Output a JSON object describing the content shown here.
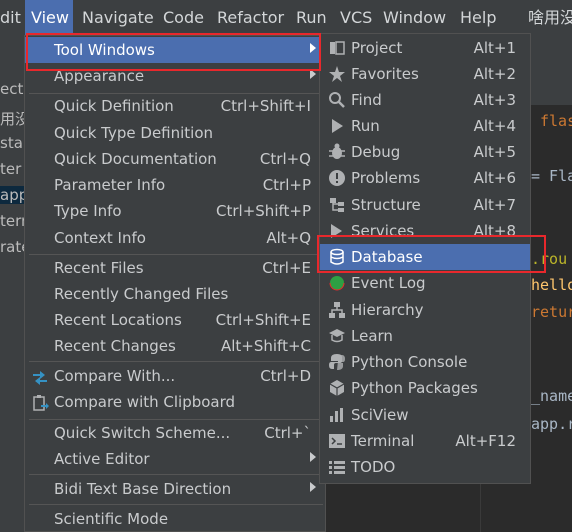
{
  "menubar": {
    "items": [
      {
        "label": "dit"
      },
      {
        "label": "View"
      },
      {
        "label": "Navigate"
      },
      {
        "label": "Code"
      },
      {
        "label": "Refactor"
      },
      {
        "label": "Run"
      },
      {
        "label": "VCS"
      },
      {
        "label": "Window"
      },
      {
        "label": "Help"
      },
      {
        "label": "啥用没"
      }
    ]
  },
  "left_panel": {
    "lines": [
      "ect",
      "用没",
      "sta",
      "ter",
      "app",
      "tern",
      "rate"
    ]
  },
  "editor": {
    "lines": [
      "flas",
      "= Fla",
      ".rou",
      "hello",
      "retur",
      "_name",
      "app.r"
    ]
  },
  "view_menu": {
    "items": [
      {
        "label": "Tool Windows",
        "shortcut": "",
        "submenu": true
      },
      {
        "label": "Appearance",
        "shortcut": "",
        "submenu": true
      },
      {
        "label": "Quick Definition",
        "shortcut": "Ctrl+Shift+I"
      },
      {
        "label": "Quick Type Definition",
        "shortcut": ""
      },
      {
        "label": "Quick Documentation",
        "shortcut": "Ctrl+Q"
      },
      {
        "label": "Parameter Info",
        "shortcut": "Ctrl+P"
      },
      {
        "label": "Type Info",
        "shortcut": "Ctrl+Shift+P"
      },
      {
        "label": "Context Info",
        "shortcut": "Alt+Q"
      },
      {
        "label": "Recent Files",
        "shortcut": "Ctrl+E"
      },
      {
        "label": "Recently Changed Files",
        "shortcut": ""
      },
      {
        "label": "Recent Locations",
        "shortcut": "Ctrl+Shift+E"
      },
      {
        "label": "Recent Changes",
        "shortcut": "Alt+Shift+C"
      },
      {
        "label": "Compare With...",
        "shortcut": "Ctrl+D"
      },
      {
        "label": "Compare with Clipboard",
        "shortcut": ""
      },
      {
        "label": "Quick Switch Scheme...",
        "shortcut": "Ctrl+`"
      },
      {
        "label": "Active Editor",
        "shortcut": "",
        "submenu": true
      },
      {
        "label": "Bidi Text Base Direction",
        "shortcut": "",
        "submenu": true
      },
      {
        "label": "Scientific Mode",
        "shortcut": ""
      }
    ]
  },
  "tool_windows_menu": {
    "items": [
      {
        "label": "Project",
        "shortcut": "Alt+1",
        "icon": "folder-icon"
      },
      {
        "label": "Favorites",
        "shortcut": "Alt+2",
        "icon": "star-icon"
      },
      {
        "label": "Find",
        "shortcut": "Alt+3",
        "icon": "search-icon"
      },
      {
        "label": "Run",
        "shortcut": "Alt+4",
        "icon": "play-icon"
      },
      {
        "label": "Debug",
        "shortcut": "Alt+5",
        "icon": "bug-icon"
      },
      {
        "label": "Problems",
        "shortcut": "Alt+6",
        "icon": "warning-icon"
      },
      {
        "label": "Structure",
        "shortcut": "Alt+7",
        "icon": "structure-icon"
      },
      {
        "label": "Services",
        "shortcut": "Alt+8",
        "icon": "services-icon"
      },
      {
        "label": "Database",
        "shortcut": "",
        "icon": "database-icon"
      },
      {
        "label": "Event Log",
        "shortcut": "",
        "icon": "event-log-icon"
      },
      {
        "label": "Hierarchy",
        "shortcut": "",
        "icon": "hierarchy-icon"
      },
      {
        "label": "Learn",
        "shortcut": "",
        "icon": "learn-icon"
      },
      {
        "label": "Python Console",
        "shortcut": "",
        "icon": "python-console-icon"
      },
      {
        "label": "Python Packages",
        "shortcut": "",
        "icon": "python-packages-icon"
      },
      {
        "label": "SciView",
        "shortcut": "",
        "icon": "sciview-icon"
      },
      {
        "label": "Terminal",
        "shortcut": "Alt+F12",
        "icon": "terminal-icon"
      },
      {
        "label": "TODO",
        "shortcut": "",
        "icon": "todo-icon"
      }
    ]
  },
  "colors": {
    "menu_bg": "#3c3f41",
    "selection": "#4b6eaf",
    "highlight_box": "#e8282c",
    "text": "#c9cbcd"
  }
}
